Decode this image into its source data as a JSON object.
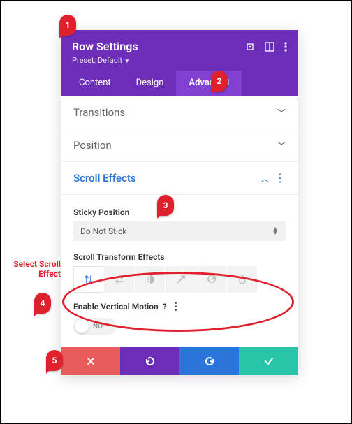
{
  "header": {
    "title": "Row Settings",
    "preset": "Preset: Default"
  },
  "tabs": {
    "content": "Content",
    "design": "Design",
    "advanced": "Advanced"
  },
  "sections": {
    "transitions": "Transitions",
    "position": "Position",
    "scroll_effects": "Scroll Effects"
  },
  "fields": {
    "sticky_position_label": "Sticky Position",
    "sticky_position_value": "Do Not Stick",
    "transform_label": "Scroll Transform Effects",
    "enable_vertical_label": "Enable Vertical Motion",
    "toggle_value": "NO"
  },
  "annotations": {
    "m1": "1",
    "m2": "2",
    "m3": "3",
    "m4": "4",
    "m5": "5",
    "callout_line1": "Select Scroll",
    "callout_line2": "Effect"
  }
}
